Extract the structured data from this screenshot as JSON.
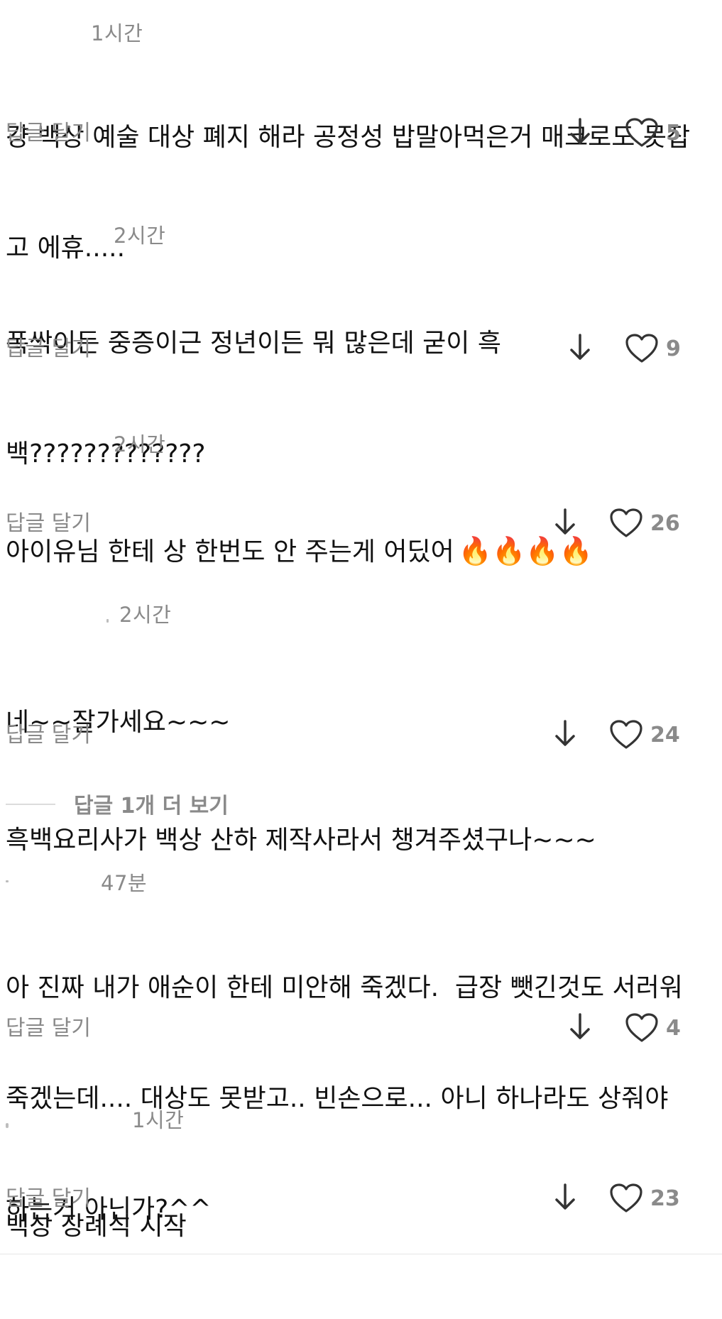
{
  "comments": [
    {
      "time": "1시간",
      "lines": [
        "걍 백상 예술 대상 폐지 해라 공정성 밥말아먹은거 매크로도 못잡",
        "고 에휴....."
      ],
      "reply_label": "답글 달기",
      "likes": "5"
    },
    {
      "time": "2시간",
      "lines": [
        "폭싹이든 중증이근 정년이든 뭐 많은데 굳이 흑",
        "백?????????????"
      ],
      "reply_label": "답글 달기",
      "likes": "9"
    },
    {
      "time": "2시간",
      "lines": [
        "아이유님 한테 상 한번도 안 주는게 어딨어"
      ],
      "emoji": "🔥🔥🔥🔥",
      "reply_label": "답글 달기",
      "likes": "26"
    },
    {
      "time": "2시간",
      "lines": [
        "네~~잘가세요~~~",
        "흑백요리사가 백상 산하 제작사라서 챙겨주셨구나~~~"
      ],
      "reply_label": "답글 달기",
      "likes": "24",
      "more_replies": "답글 1개 더 보기"
    },
    {
      "time": "47분",
      "lines": [
        "아 진짜 내가 애순이 한테 미안해 죽겠다.  급장 뺏긴것도 서러워",
        "죽겠는데.... 대상도 못받고.. 빈손으로... 아니 하나라도 상줘야",
        "하는거 아닌가?^^"
      ],
      "reply_label": "답글 달기",
      "likes": "4"
    },
    {
      "time": "1시간",
      "lines": [
        "백상 장례식 시작"
      ],
      "reply_label": "답글 달기",
      "likes": "23"
    }
  ],
  "icons": {
    "down": "arrow-down-icon",
    "like": "heart-outline-icon",
    "emoji": "fire-emoji"
  }
}
